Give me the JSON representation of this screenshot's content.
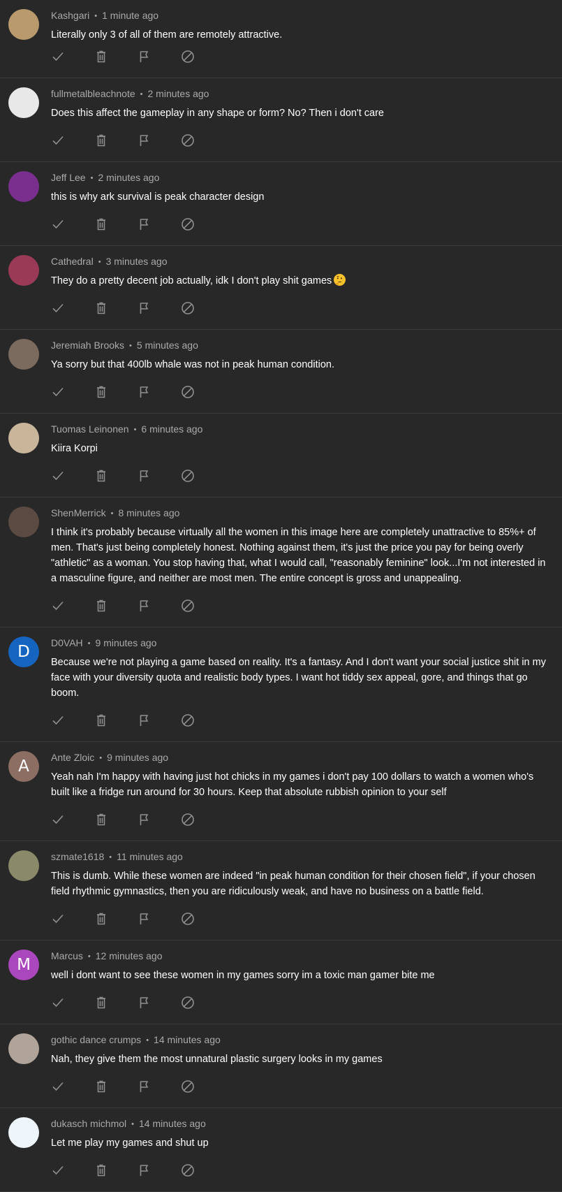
{
  "comments": [
    {
      "author": "Kashgari",
      "time": "1 minute ago",
      "text": "Literally only 3 of all of them are remotely attractive.",
      "avatar": {
        "initial": "",
        "color": "#b89a6c"
      }
    },
    {
      "author": "fullmetalbleachnote",
      "time": "2 minutes ago",
      "text": "Does this affect the gameplay in any shape or form? No? Then i don't care",
      "avatar": {
        "initial": "",
        "color": "#e8e8e8"
      }
    },
    {
      "author": "Jeff Lee",
      "time": "2 minutes ago",
      "text": "this is why ark survival is peak character design",
      "avatar": {
        "initial": "",
        "color": "#7a2f8f"
      }
    },
    {
      "author": "Cathedral",
      "time": "3 minutes ago",
      "text": "They do a pretty decent job actually, idk I don't play shit games",
      "emoji": "thinking-face",
      "avatar": {
        "initial": "",
        "color": "#9a3a56"
      }
    },
    {
      "author": "Jeremiah Brooks",
      "time": "5 minutes ago",
      "text": "Ya sorry but that 400lb whale was not in peak human condition.",
      "avatar": {
        "initial": "",
        "color": "#7b6a5e"
      }
    },
    {
      "author": "Tuomas Leinonen",
      "time": "6 minutes ago",
      "text": "Kiira Korpi",
      "avatar": {
        "initial": "",
        "color": "#c9b69a"
      }
    },
    {
      "author": "ShenMerrick",
      "time": "8 minutes ago",
      "text": "I think it's probably because virtually all the women in this image here are completely unattractive to 85%+ of men. That's just being completely honest. Nothing against them, it's just the price you pay for being overly \"athletic\" as a woman. You stop having that, what I would call, \"reasonably feminine\" look...I'm not interested in a masculine figure, and neither are most men. The entire concept is gross and unappealing.",
      "avatar": {
        "initial": "",
        "color": "#5b4a42"
      }
    },
    {
      "author": "D0VAH",
      "time": "9 minutes ago",
      "text": "Because we're not playing a game based on reality. It's a fantasy. And I don't want your social justice shit in my face with your diversity quota and realistic body types. I want hot tiddy sex appeal, gore, and things that go boom.",
      "avatar": {
        "initial": "D",
        "color": "#1565c0"
      }
    },
    {
      "author": "Ante Zloic",
      "time": "9 minutes ago",
      "text": "Yeah nah I'm happy with having just hot chicks in my games i don't pay 100 dollars to watch a women who's built like a fridge run around for 30 hours. Keep that absolute rubbish opinion to your self",
      "avatar": {
        "initial": "A",
        "color": "#8d6e63"
      }
    },
    {
      "author": "szmate1618",
      "time": "11 minutes ago",
      "text": "This is dumb. While these women are indeed \"in peak human condition for their chosen field\", if your chosen field rhythmic gymnastics, then you are ridiculously weak, and have no business on a battle field.",
      "avatar": {
        "initial": "",
        "color": "#8a8a6a"
      }
    },
    {
      "author": "Marcus",
      "time": "12 minutes ago",
      "text": "well i dont want to see these women in my games  sorry im a toxic man gamer   bite me",
      "avatar": {
        "initial": "M",
        "color": "#ab47bc"
      }
    },
    {
      "author": "gothic dance crumps",
      "time": "14 minutes ago",
      "text": "Nah, they give them the most unnatural plastic surgery looks in my games",
      "avatar": {
        "initial": "",
        "color": "#b0a49a"
      }
    },
    {
      "author": "dukasch michmol",
      "time": "14 minutes ago",
      "text": "Let me play my games and shut up",
      "avatar": {
        "initial": "",
        "color": "#eef6fb"
      }
    }
  ],
  "actions": [
    {
      "name": "approve",
      "icon": "checkmark-icon"
    },
    {
      "name": "remove",
      "icon": "trash-icon"
    },
    {
      "name": "report",
      "icon": "flag-icon"
    },
    {
      "name": "hide-user",
      "icon": "block-icon"
    }
  ],
  "colors": {
    "background": "#282828",
    "divider": "#3a3a3a",
    "meta": "#aaaaaa",
    "text": "#ffffff",
    "icon": "#909090"
  }
}
